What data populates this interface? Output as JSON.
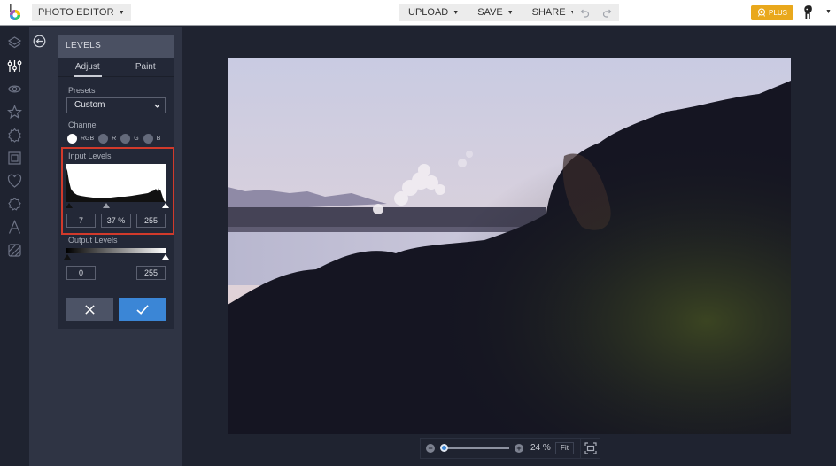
{
  "topbar": {
    "app_menu_label": "PHOTO EDITOR",
    "menus": [
      {
        "label": "UPLOAD"
      },
      {
        "label": "SAVE"
      },
      {
        "label": "SHARE"
      }
    ],
    "undo_icon": "undo-icon",
    "redo_icon": "redo-icon",
    "plus_label": "PLUS",
    "plus_color": "#e9a81c",
    "user_icon": "user-avatar-icon"
  },
  "iconbar": {
    "items": [
      {
        "icon": "layers-icon",
        "active": false
      },
      {
        "icon": "sliders-icon",
        "active": true
      },
      {
        "icon": "eye-icon",
        "active": false
      },
      {
        "icon": "star-icon",
        "active": false
      },
      {
        "icon": "gear-badge-icon",
        "active": false
      },
      {
        "icon": "frame-icon",
        "active": false
      },
      {
        "icon": "heart-icon",
        "active": false
      },
      {
        "icon": "badge-icon",
        "active": false
      },
      {
        "icon": "text-icon",
        "active": false
      },
      {
        "icon": "texture-icon",
        "active": false
      }
    ]
  },
  "panel": {
    "title": "LEVELS",
    "tabs": [
      {
        "label": "Adjust",
        "active": true
      },
      {
        "label": "Paint",
        "active": false
      }
    ],
    "presets_label": "Presets",
    "preset_value": "Custom",
    "channel_label": "Channel",
    "channels": [
      {
        "label": "RGB",
        "selected": true
      },
      {
        "label": "R",
        "selected": false
      },
      {
        "label": "G",
        "selected": false
      },
      {
        "label": "B",
        "selected": false
      }
    ],
    "input_levels_label": "Input Levels",
    "input_black": "7",
    "input_mid": "37 %",
    "input_white": "255",
    "output_levels_label": "Output Levels",
    "output_black": "0",
    "output_white": "255",
    "highlight_color": "#d13a2b",
    "confirm_color": "#3b86d6"
  },
  "canvas": {
    "zoom_percent": "24 %",
    "fit_label": "Fit",
    "zoom_slider_value": 0.0
  }
}
